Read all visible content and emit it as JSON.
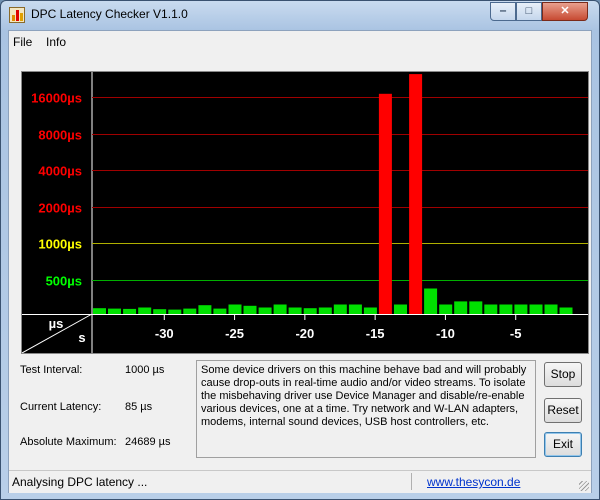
{
  "window": {
    "title": "DPC Latency Checker V1.1.0",
    "controls": {
      "minimize": "‒",
      "maximize": "□",
      "close": "✕"
    }
  },
  "menu": [
    {
      "label": "File"
    },
    {
      "label": "Info"
    }
  ],
  "chart_data": {
    "type": "bar",
    "ylabels": [
      {
        "label": "16000µs",
        "value": 16000,
        "color": "#ff0000"
      },
      {
        "label": "8000µs",
        "value": 8000,
        "color": "#ff0000"
      },
      {
        "label": "4000µs",
        "value": 4000,
        "color": "#ff0000"
      },
      {
        "label": "2000µs",
        "value": 2000,
        "color": "#ff0000"
      },
      {
        "label": "1000µs",
        "value": 1000,
        "color": "#ffff00"
      },
      {
        "label": "500µs",
        "value": 500,
        "color": "#00ff00"
      }
    ],
    "corner_labels": {
      "y": "µs",
      "x": "s"
    },
    "xticks": [
      "-30",
      "-25",
      "-20",
      "-15",
      "-10",
      "-5"
    ],
    "x_range": [
      -35,
      0
    ],
    "bar_values_us": [
      85,
      80,
      75,
      95,
      70,
      65,
      80,
      130,
      80,
      140,
      120,
      95,
      140,
      95,
      85,
      95,
      140,
      140,
      95,
      17000,
      140,
      24689,
      375,
      140,
      185,
      185,
      140,
      140,
      140,
      140,
      140,
      95
    ],
    "bar_colors": {
      "normal": "#00e000",
      "high": "#ff0000"
    },
    "high_threshold_us": 2000,
    "scale": "log2"
  },
  "info": {
    "test_interval": {
      "label": "Test Interval:",
      "value": "1000 µs"
    },
    "current_latency": {
      "label": "Current Latency:",
      "value": "85 µs"
    },
    "absolute_maximum": {
      "label": "Absolute Maximum:",
      "value": "24689 µs"
    }
  },
  "description": "Some device drivers on this machine behave bad and will probably cause drop-outs in real-time audio and/or video streams. To isolate the misbehaving driver use Device Manager and disable/re-enable various devices, one at a time. Try network and W-LAN adapters, modems, internal sound devices, USB host controllers, etc.",
  "buttons": {
    "stop": "Stop",
    "reset": "Reset",
    "exit": "Exit"
  },
  "status": {
    "text": "Analysing DPC latency ...",
    "link": "www.thesycon.de"
  }
}
